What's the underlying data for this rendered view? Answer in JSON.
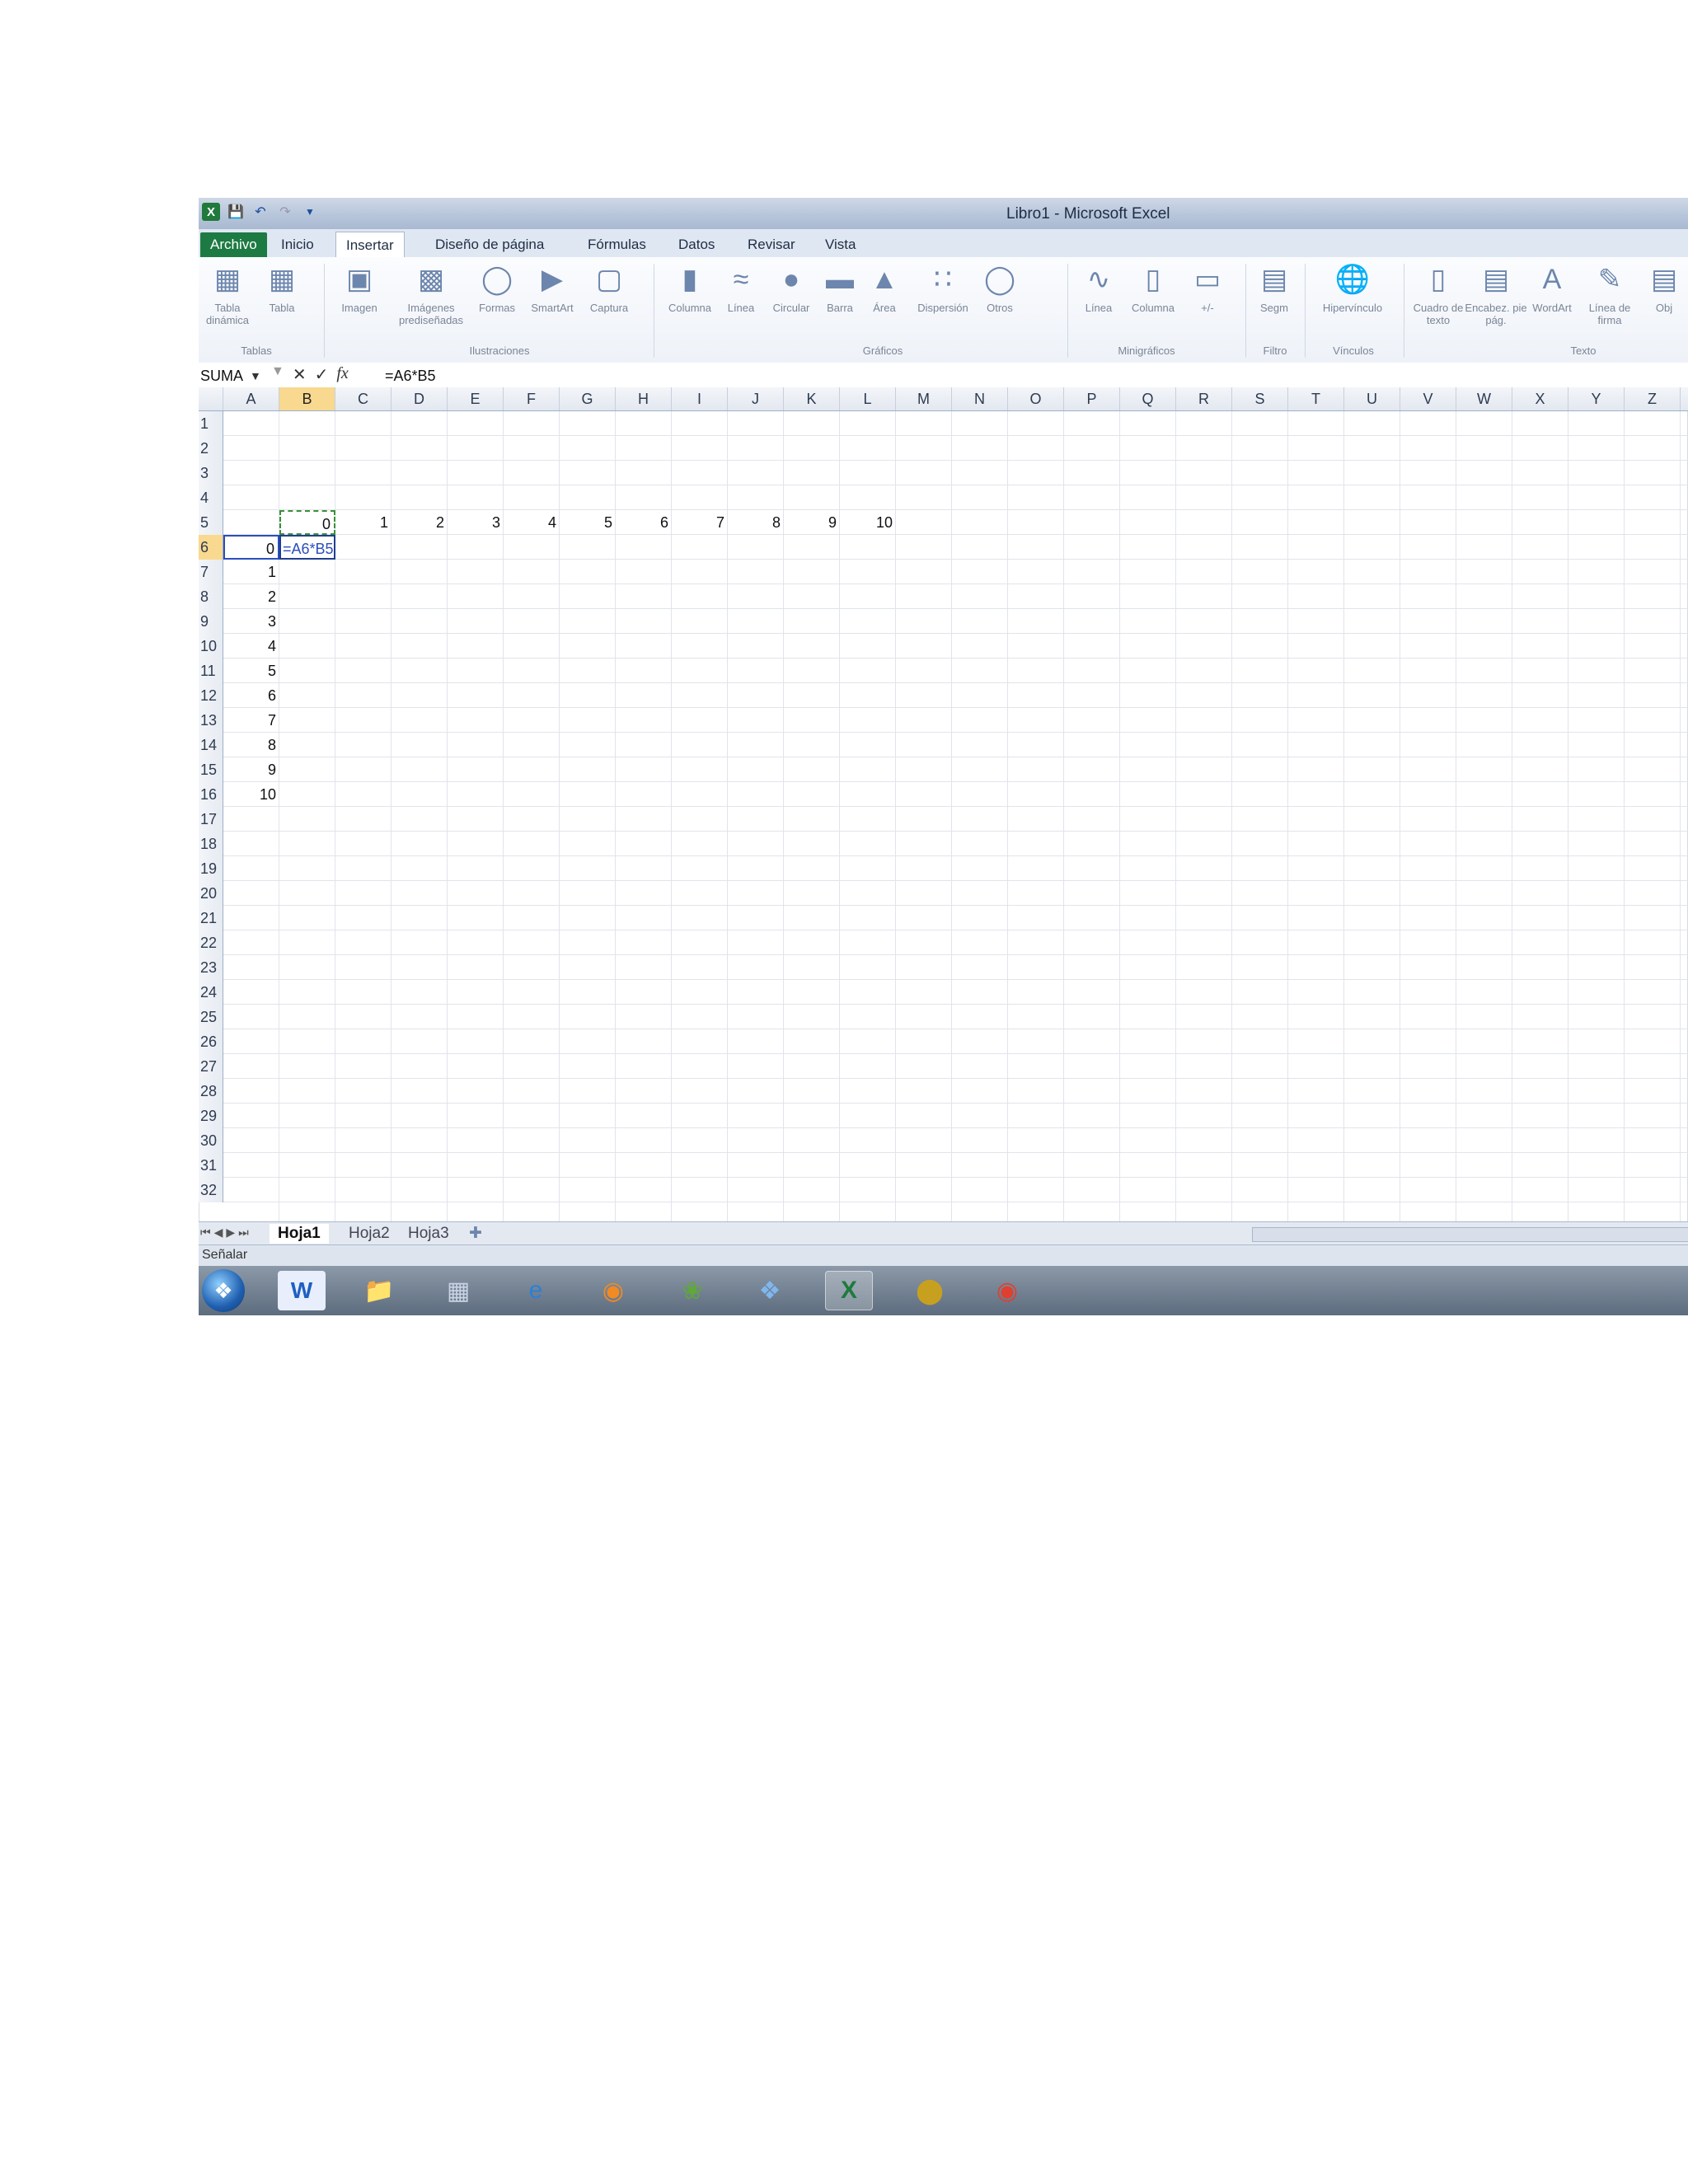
{
  "window_title": "Libro1 - Microsoft Excel",
  "ribbon_tabs": [
    "Archivo",
    "Inicio",
    "Insertar",
    "Diseño de página",
    "Fórmulas",
    "Datos",
    "Revisar",
    "Vista"
  ],
  "ribbon_buttons": {
    "tabla_dinamica": "Tabla dinámica",
    "tabla": "Tabla",
    "imagen": "Imagen",
    "imagenes_prediseñadas": "Imágenes prediseñadas",
    "formas": "Formas",
    "smartart": "SmartArt",
    "captura": "Captura",
    "columna": "Columna",
    "linea": "Línea",
    "circular": "Circular",
    "barra": "Barra",
    "area": "Área",
    "dispersion": "Dispersión",
    "otros": "Otros",
    "mini_linea": "Línea",
    "mini_columna": "Columna",
    "mini_ganancia": "+/-",
    "segm": "Segm",
    "hipervinculo": "Hipervínculo",
    "cuadro_texto": "Cuadro de texto",
    "encabez": "Encabez. pie pág.",
    "wordart": "WordArt",
    "linea_firma": "Línea de firma",
    "objeto": "Obj"
  },
  "ribbon_groups": {
    "tablas": "Tablas",
    "ilustraciones": "Ilustraciones",
    "graficos": "Gráficos",
    "minigraficos": "Minigráficos",
    "filtro": "Filtro",
    "vinculos": "Vínculos",
    "texto": "Texto"
  },
  "name_box": "SUMA",
  "formula": "=A6*B5",
  "columns": [
    "A",
    "B",
    "C",
    "D",
    "E",
    "F",
    "G",
    "H",
    "I",
    "J",
    "K",
    "L",
    "M",
    "N",
    "O",
    "P",
    "Q",
    "R",
    "S",
    "T",
    "U",
    "V",
    "W",
    "X",
    "Y",
    "Z"
  ],
  "rows": [
    "1",
    "2",
    "3",
    "4",
    "5",
    "6",
    "7",
    "8",
    "9",
    "10",
    "11",
    "12",
    "13",
    "14",
    "15",
    "16",
    "17",
    "18",
    "19",
    "20",
    "21",
    "22",
    "23",
    "24",
    "25",
    "26",
    "27",
    "28",
    "29",
    "30",
    "31",
    "32"
  ],
  "row5_values": [
    "0",
    "1",
    "2",
    "3",
    "4",
    "5",
    "6",
    "7",
    "8",
    "9",
    "10"
  ],
  "colA_values": [
    "0",
    "1",
    "2",
    "3",
    "4",
    "5",
    "6",
    "7",
    "8",
    "9",
    "10"
  ],
  "editing_cell": "=A6*B5",
  "sheet_tabs": [
    "Hoja1",
    "Hoja2",
    "Hoja3"
  ],
  "status": "Señalar",
  "taskbar_icons": [
    "word-icon",
    "explorer-icon",
    "calculator-icon",
    "ie-icon",
    "media-icon",
    "leaf-icon",
    "dropbox-icon",
    "excel-icon",
    "egg-icon",
    "chrome-icon"
  ]
}
